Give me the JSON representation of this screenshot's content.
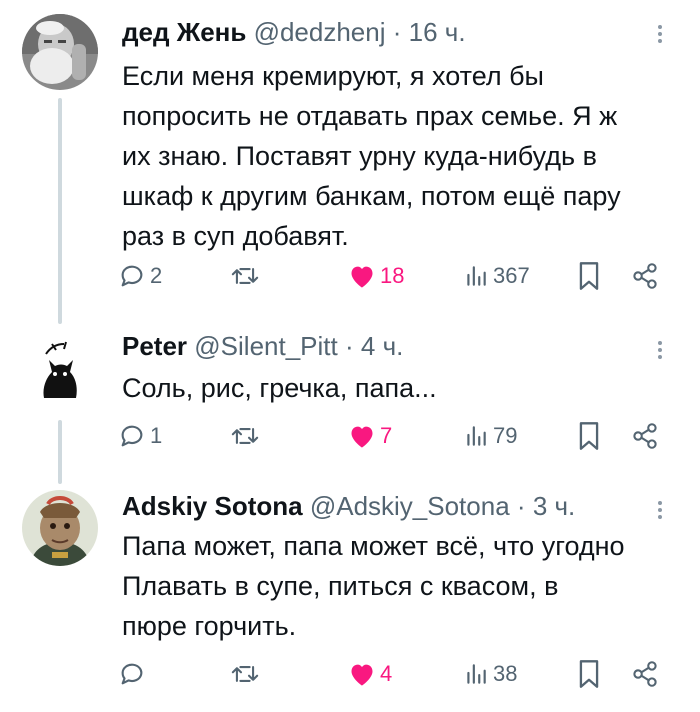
{
  "tweets": [
    {
      "name": "дед Жень",
      "handle": "@dedzhenj",
      "sep": "·",
      "time": "16 ч.",
      "lines": [
        "Если меня кремируют, я хотел бы",
        "попросить не отдавать прах семье. Я ж",
        "их знаю. Поставят урну куда-нибудь в",
        "шкаф к другим банкам, потом ещё пару",
        "раз в суп добавят."
      ],
      "replies": "2",
      "retweets": "",
      "likes": "18",
      "views": "367"
    },
    {
      "name": "Peter",
      "handle": "@Silent_Pitt",
      "sep": "·",
      "time": "4 ч.",
      "lines": [
        "Соль, рис, гречка, папа..."
      ],
      "replies": "1",
      "retweets": "",
      "likes": "7",
      "views": "79"
    },
    {
      "name": "Adskiy Sotona",
      "handle": "@Adskiy_Sotona",
      "sep": "·",
      "time": "3 ч.",
      "lines": [
        "Папа может, папа может всё, что угодно",
        "Плавать в супе,  питься с квасом, в",
        "пюре горчить."
      ],
      "replies": "",
      "retweets": "",
      "likes": "4",
      "views": "38"
    }
  ],
  "colors": {
    "like": "#f91880",
    "icon": "#536471",
    "text": "#0f1419",
    "thread_line": "#cfd9de"
  }
}
